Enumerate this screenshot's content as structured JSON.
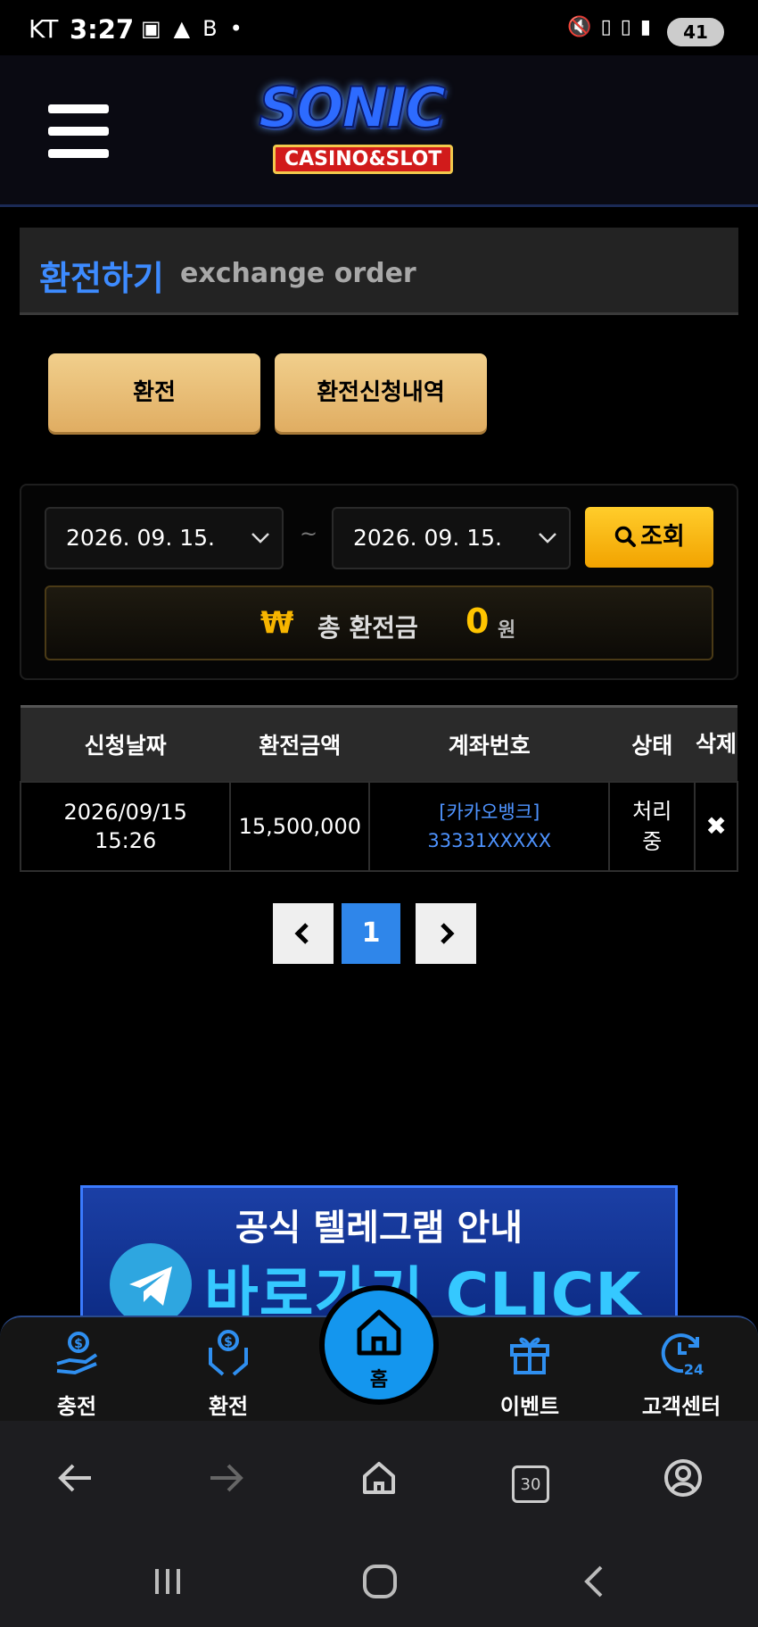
{
  "status_bar": {
    "carrier": "KT",
    "time": "3:27",
    "battery": "41",
    "icons": [
      "screenshot-icon",
      "alert-icon",
      "b-icon",
      "mute-icon",
      "hd-icon",
      "5g-icon",
      "signal-icon"
    ]
  },
  "header": {
    "logo_main": "SONIC",
    "logo_sub": "CASINO&SLOT"
  },
  "title": {
    "korean": "환전하기",
    "english": "exchange order"
  },
  "tabs": [
    {
      "label": "환전"
    },
    {
      "label": "환전신청내역"
    }
  ],
  "filter": {
    "start_date": "2026. 09. 15.",
    "separator": "~",
    "end_date": "2026. 09. 15.",
    "search_label": "조회"
  },
  "total": {
    "currency_symbol": "₩",
    "label": "총 환전금",
    "amount": "0",
    "unit": "원"
  },
  "table": {
    "headers": [
      "신청날짜",
      "환전금액",
      "계좌번호",
      "상태",
      "삭제"
    ],
    "rows": [
      {
        "date": "2026/09/15",
        "time": "15:26",
        "amount": "15,500,000",
        "bank": "[카카오뱅크]",
        "account": "33331XXXXX",
        "status": "처리중",
        "delete": "✖"
      }
    ]
  },
  "pagination": {
    "prev": "‹",
    "current": "1",
    "next": "›"
  },
  "banner": {
    "line1": "공식 텔레그램 안내",
    "line2": "바로가기 CLICK"
  },
  "bottom_nav": {
    "charge": "충전",
    "exchange": "환전",
    "home": "홈",
    "event": "이벤트",
    "customer_center": "고객센터"
  },
  "browser": {
    "tab_count": "30"
  },
  "colors": {
    "accent_blue": "#3d8bff",
    "gold": "#ffc400",
    "tab_gold": "#e8be78",
    "home_blue": "#1496ee"
  }
}
